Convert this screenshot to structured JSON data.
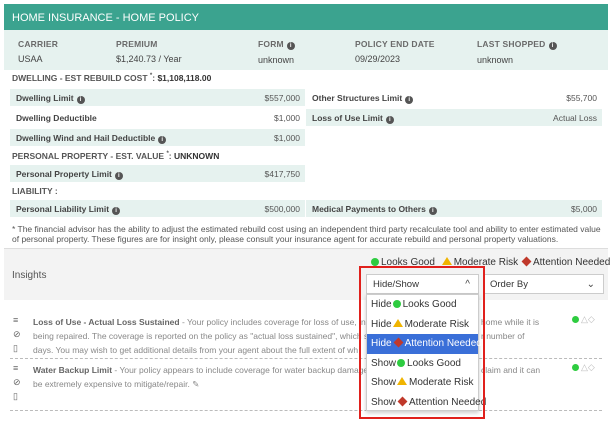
{
  "header": {
    "title": "HOME INSURANCE - HOME POLICY"
  },
  "summary": {
    "carrier_label": "CARRIER",
    "carrier_value": "USAA",
    "premium_label": "PREMIUM",
    "premium_value": "$1,240.73 / Year",
    "form_label": "FORM",
    "form_value": "unknown",
    "end_label": "POLICY END DATE",
    "end_value": "09/29/2023",
    "shopped_label": "LAST SHOPPED",
    "shopped_value": "unknown"
  },
  "dwelling": {
    "heading": "DWELLING - EST REBUILD COST ",
    "heading_star": "*",
    "heading_value": "$1,108,118.00",
    "rows": [
      {
        "label": "Dwelling Limit",
        "value": "$557,000"
      },
      {
        "label": "Other Structures Limit",
        "value": "$55,700"
      },
      {
        "label": "Dwelling Deductible",
        "value": "$1,000"
      },
      {
        "label": "Loss of Use Limit",
        "value": "Actual Loss"
      },
      {
        "label": "Dwelling Wind and Hail Deductible",
        "value": "$1,000"
      }
    ]
  },
  "personal_property": {
    "heading": "PERSONAL PROPERTY - EST. VALUE ",
    "heading_star": "*",
    "heading_value": "UNKNOWN",
    "rows": [
      {
        "label": "Personal Property Limit",
        "value": "$417,750"
      }
    ]
  },
  "liability": {
    "heading": "LIABILITY :",
    "rows": [
      {
        "label": "Personal Liability Limit",
        "value": "$500,000"
      },
      {
        "label": "Medical Payments to Others",
        "value": "$5,000"
      }
    ]
  },
  "footnote": "* The financial advisor has the ability to adjust the estimated rebuild cost using an independent third party recalculate tool and ability to enter estimated value of personal property. These figures are for insight only, please consult your insurance agent for accurate rebuild and personal property valuations.",
  "insights": {
    "title": "Insights",
    "legend": {
      "good": "Looks Good",
      "moderate": "Moderate Risk",
      "attention": "Attention Needed"
    },
    "hide_show": {
      "value": "Hide/Show"
    },
    "order_by": {
      "value": "Order By"
    },
    "dropdown_options": [
      "Looks Good",
      "Moderate Risk",
      "Attention Needed",
      "Looks Good",
      "Moderate Risk",
      "Attention Needed"
    ],
    "dropdown_prefix": [
      "Hide",
      "Hide",
      "Hide",
      "Show",
      "Show",
      "Show"
    ],
    "items": [
      {
        "title": "Loss of Use - Actual Loss Sustained",
        "line1": " - Your policy includes coverage for loss of use, in ca",
        "line1_right": "home while it is",
        "line2": "being repaired. The coverage is reported on the policy as \"actual loss sustained\", which s",
        "line2_right": "r number of",
        "line3": "days. You may wish to get additional details from your agent about the full extent of wh"
      },
      {
        "title": "Water Backup Limit",
        "line1": " - Your policy appears to include coverage for water backup damage",
        "line1_right": "claim and it can",
        "line2": "be extremely expensive to mitigate/repair."
      }
    ]
  },
  "colors": {
    "header": "#3ba38f",
    "good": "#2ecc40",
    "moderate": "#f0b400",
    "attention": "#c0392b",
    "selected": "#3a6fd8",
    "highlight": "#e0201c"
  }
}
